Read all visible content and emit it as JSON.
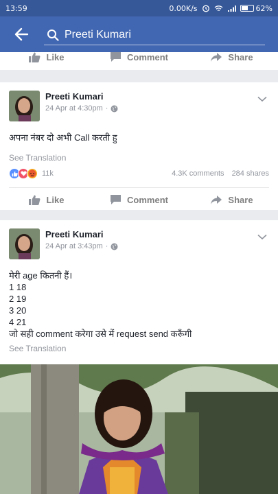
{
  "status_bar": {
    "time": "13:59",
    "speed": "0.00K/s",
    "battery": "62%",
    "battery_level": 0.62
  },
  "app_bar": {
    "search_query": "Preeti Kumari"
  },
  "actions": {
    "like": "Like",
    "comment": "Comment",
    "share": "Share"
  },
  "posts": [
    {
      "author": "Preeti Kumari",
      "timestamp": "24 Apr at 4:30pm",
      "text": "अपना नंबर दो अभी Call करती हु",
      "see_translation": "See Translation",
      "reactions_count": "11k",
      "comments": "4.3K comments",
      "shares": "284 shares"
    },
    {
      "author": "Preeti Kumari",
      "timestamp": "24 Apr at 3:43pm",
      "lines": [
        "मेरी age कितनी हैं।",
        "1 18",
        "2 19",
        "3 20",
        "4 21",
        "जो सही comment करेगा उसे में request send करूँगी"
      ],
      "see_translation": "See Translation"
    }
  ],
  "colors": {
    "brand_blue": "#4267b2",
    "status_blue": "#365899",
    "feed_bg": "#e9ebee",
    "muted": "#90949c"
  }
}
